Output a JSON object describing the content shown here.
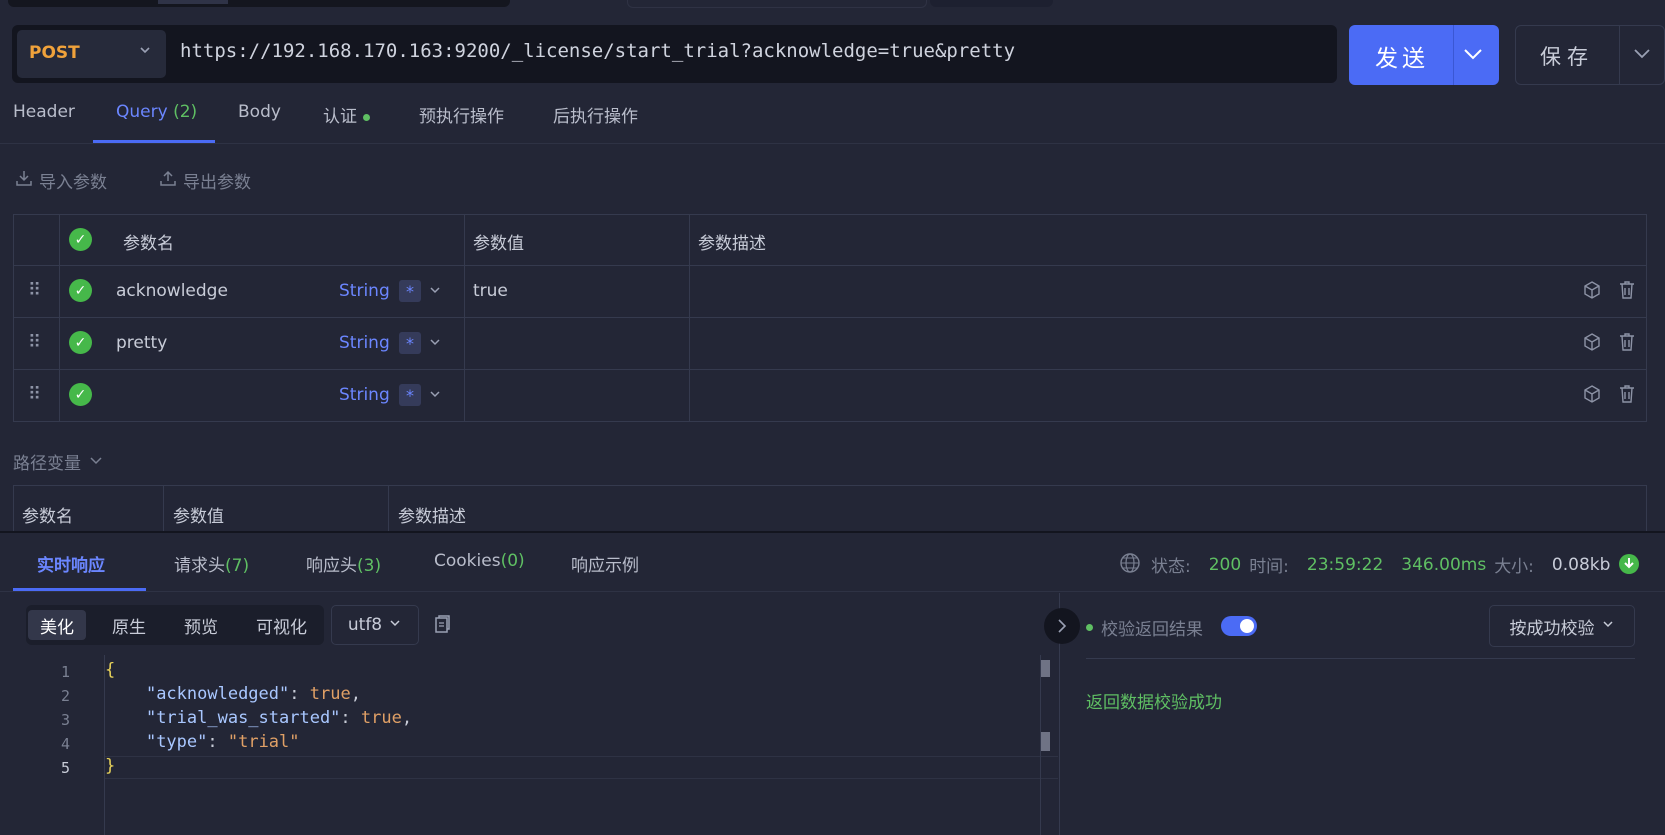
{
  "request": {
    "method": "POST",
    "url": "https://192.168.170.163:9200/_license/start_trial?acknowledge=true&pretty",
    "send_label": "发送",
    "save_label": "保存"
  },
  "tabs": [
    {
      "label": "Header"
    },
    {
      "label": "Query",
      "count": "(2)"
    },
    {
      "label": "Body"
    },
    {
      "label": "认证"
    },
    {
      "label": "预执行操作"
    },
    {
      "label": "后执行操作"
    }
  ],
  "toolbar": {
    "import_label": "导入参数",
    "export_label": "导出参数"
  },
  "params": {
    "headers": [
      "参数名",
      "参数值",
      "参数描述"
    ],
    "rows": [
      {
        "name": "acknowledge",
        "type": "String",
        "required": "*",
        "value": "true",
        "desc": ""
      },
      {
        "name": "pretty",
        "type": "String",
        "required": "*",
        "value": "",
        "desc": ""
      },
      {
        "name": "",
        "type": "String",
        "required": "*",
        "value": "",
        "desc": ""
      }
    ]
  },
  "path_vars": {
    "title": "路径变量",
    "headers": [
      "参数名",
      "参数值",
      "参数描述"
    ]
  },
  "response": {
    "tabs": [
      {
        "label": "实时响应"
      },
      {
        "label": "请求头",
        "count": "(7)"
      },
      {
        "label": "响应头",
        "count": "(3)"
      },
      {
        "label": "Cookies",
        "count": "(0)"
      },
      {
        "label": "响应示例"
      }
    ],
    "status": {
      "status_label": "状态:",
      "status_value": "200",
      "time_label": "时间:",
      "time_value": "23:59:22",
      "duration": "346.00ms",
      "size_label": "大小:",
      "size_value": "0.08kb"
    },
    "format_buttons": [
      "美化",
      "原生",
      "预览",
      "可视化"
    ],
    "encoding": "utf8",
    "line_numbers": [
      "1",
      "2",
      "3",
      "4",
      "5"
    ],
    "body": {
      "open_brace": "{",
      "k1": "\"acknowledged\"",
      "v1": "true",
      "k2": "\"trial_was_started\"",
      "v2": "true",
      "k3": "\"type\"",
      "v3": "\"trial\"",
      "close_brace": "}"
    },
    "verify": {
      "label": "校验返回结果",
      "mode": "按成功校验",
      "result": "返回数据校验成功"
    }
  },
  "colors": {
    "accent": "#4b6bf5",
    "method": "#f0a23b",
    "success": "#5fbf63"
  }
}
